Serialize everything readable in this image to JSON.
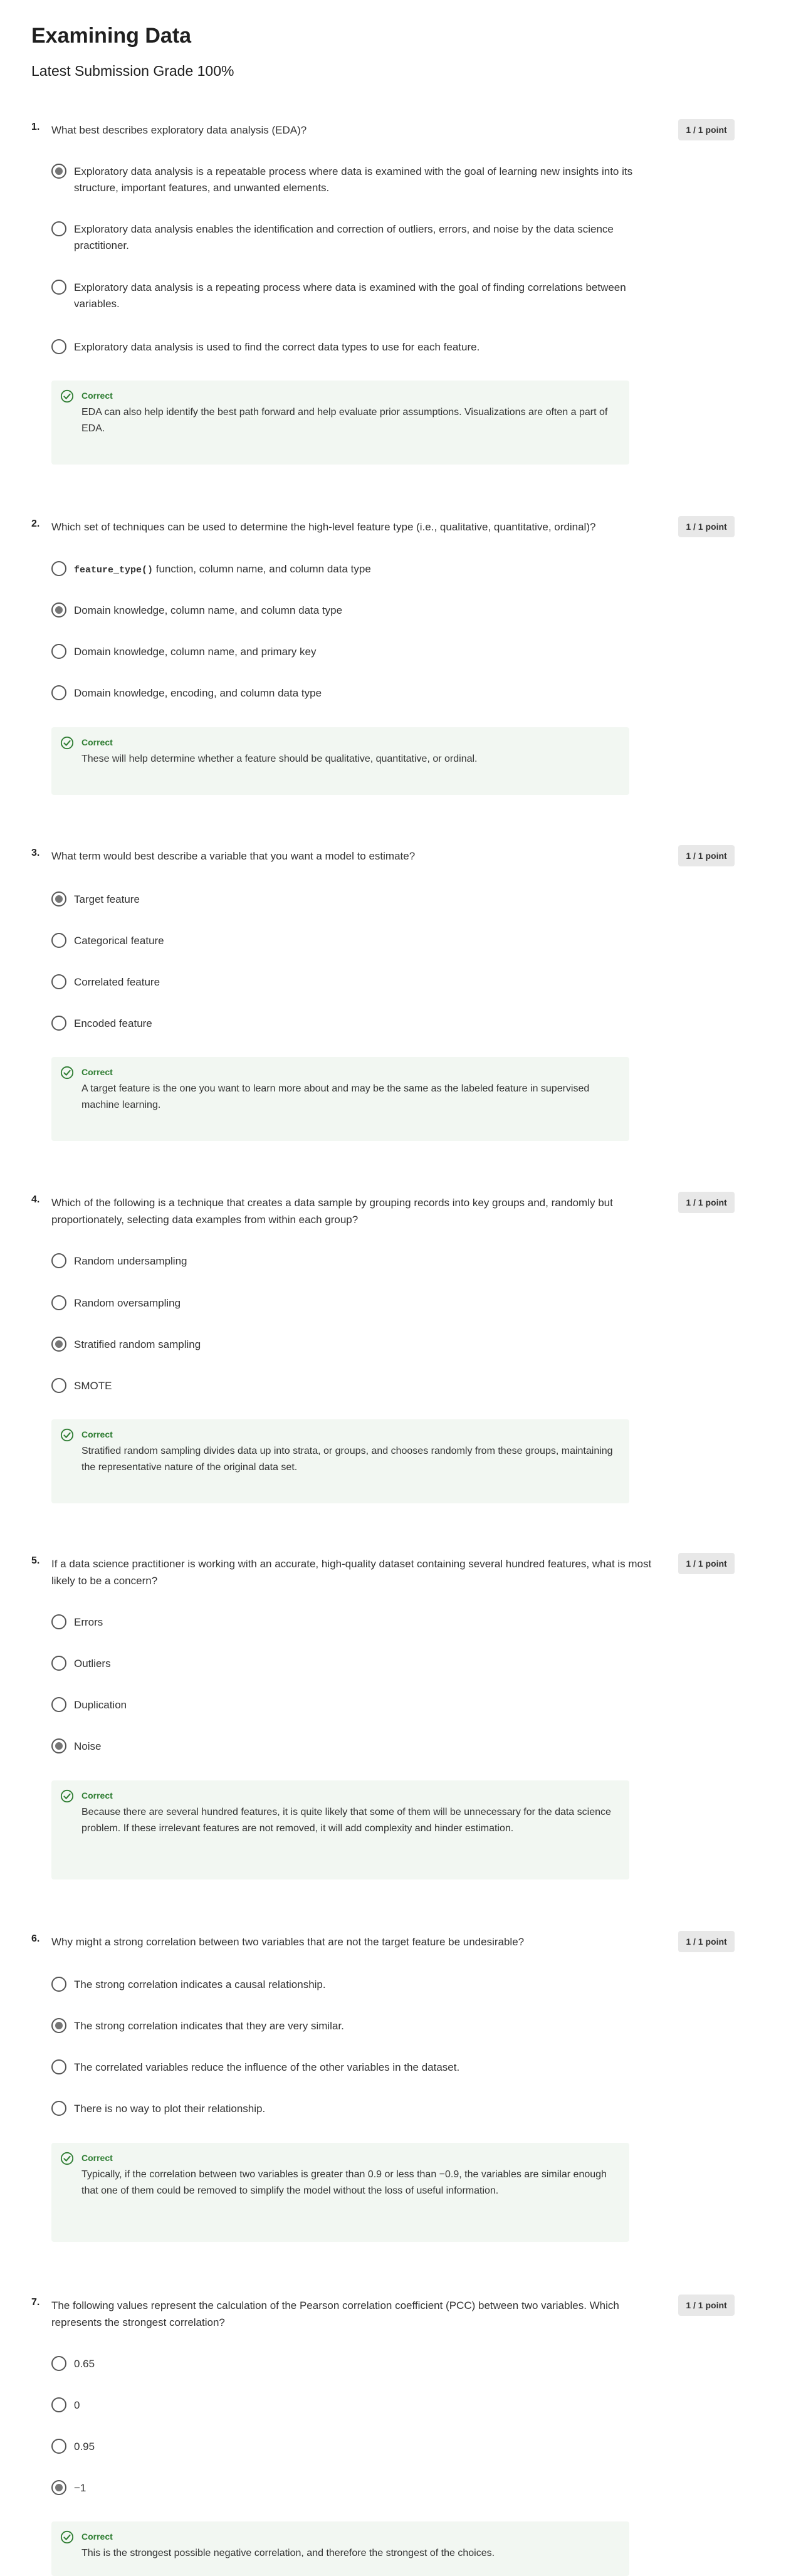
{
  "page": {
    "title": "Examining Data",
    "grade": "Latest Submission Grade 100%"
  },
  "icons": {
    "correct": "check-circle-icon",
    "radio": "radio-button-icon"
  },
  "colors": {
    "correct_green": "#2e7d32",
    "feedback_bg": "#f2f7f2",
    "points_bg": "#e8e8e8"
  },
  "questions": [
    {
      "number": "1.",
      "text": "What best describes exploratory data analysis (EDA)?",
      "points": "1 / 1 point",
      "options": [
        {
          "text": "Exploratory data analysis is a repeatable process where data is examined with the goal of learning new insights into its structure, important features, and unwanted elements.",
          "selected": true
        },
        {
          "text": "Exploratory data analysis enables the identification and correction of outliers, errors, and noise by the data science practitioner.",
          "selected": false
        },
        {
          "text": "Exploratory data analysis is a repeating process where data is examined with the goal of finding correlations between variables.",
          "selected": false
        },
        {
          "text": "Exploratory data analysis is used to find the correct data types to use for each feature.",
          "selected": false
        }
      ],
      "feedback": {
        "label": "Correct",
        "text": "EDA can also help identify the best path forward and help evaluate prior assumptions. Visualizations are often a part of EDA."
      }
    },
    {
      "number": "2.",
      "text": "Which set of techniques can be used to determine the high-level feature type (i.e., qualitative, quantitative, ordinal)?",
      "points": "1 / 1 point",
      "options": [
        {
          "code": "feature_type()",
          "text": " function, column name, and column data type",
          "selected": false
        },
        {
          "text": "Domain knowledge, column name, and column data type",
          "selected": true
        },
        {
          "text": "Domain knowledge, column name, and primary key",
          "selected": false
        },
        {
          "text": "Domain knowledge, encoding, and column data type",
          "selected": false
        }
      ],
      "feedback": {
        "label": "Correct",
        "text": "These will help determine whether a feature should be qualitative, quantitative, or ordinal."
      }
    },
    {
      "number": "3.",
      "text": "What term would best describe a variable that you want a model to estimate?",
      "points": "1 / 1 point",
      "options": [
        {
          "text": "Target feature",
          "selected": true
        },
        {
          "text": "Categorical feature",
          "selected": false
        },
        {
          "text": "Correlated feature",
          "selected": false
        },
        {
          "text": "Encoded feature",
          "selected": false
        }
      ],
      "feedback": {
        "label": "Correct",
        "text": "A target feature is the one you want to learn more about and may be the same as the labeled feature in supervised machine learning."
      }
    },
    {
      "number": "4.",
      "text": "Which of the following is a technique that creates a data sample by grouping records into key groups and, randomly but proportionately, selecting data examples from within each group?",
      "points": "1 / 1 point",
      "options": [
        {
          "text": "Random undersampling",
          "selected": false
        },
        {
          "text": "Random oversampling",
          "selected": false
        },
        {
          "text": "Stratified random sampling",
          "selected": true
        },
        {
          "text": "SMOTE",
          "selected": false
        }
      ],
      "feedback": {
        "label": "Correct",
        "text": "Stratified random sampling divides data up into strata, or groups, and chooses randomly from these groups, maintaining the representative nature of the original data set."
      }
    },
    {
      "number": "5.",
      "text": "If a data science practitioner is working with an accurate, high-quality dataset containing several hundred features, what is most likely to be a concern?",
      "points": "1 / 1 point",
      "options": [
        {
          "text": "Errors",
          "selected": false
        },
        {
          "text": "Outliers",
          "selected": false
        },
        {
          "text": "Duplication",
          "selected": false
        },
        {
          "text": "Noise",
          "selected": true
        }
      ],
      "feedback": {
        "label": "Correct",
        "text": "Because there are several hundred features, it is quite likely that some of them will be unnecessary for the data science problem. If these irrelevant features are not removed, it will add complexity and hinder estimation."
      }
    },
    {
      "number": "6.",
      "text": "Why might a strong correlation between two variables that are not the target feature be undesirable?",
      "points": "1 / 1 point",
      "options": [
        {
          "text": "The strong correlation indicates a causal relationship.",
          "selected": false
        },
        {
          "text": "The strong correlation indicates that they are very similar.",
          "selected": true
        },
        {
          "text": "The correlated variables reduce the influence of the other variables in the dataset.",
          "selected": false
        },
        {
          "text": "There is no way to plot their relationship.",
          "selected": false
        }
      ],
      "feedback": {
        "label": "Correct",
        "text": "Typically, if the correlation between two variables is greater than 0.9 or less than −0.9, the variables are similar enough that one of them could be removed to simplify the model without the loss of useful information."
      }
    },
    {
      "number": "7.",
      "text": "The following values represent the calculation of the Pearson correlation coefficient (PCC) between two variables. Which represents the strongest correlation?",
      "points": "1 / 1 point",
      "options": [
        {
          "text": "0.65",
          "selected": false
        },
        {
          "text": "0",
          "selected": false
        },
        {
          "text": "0.95",
          "selected": false
        },
        {
          "text": "−1",
          "selected": true
        }
      ],
      "feedback": {
        "label": "Correct",
        "text": "This is the strongest possible negative correlation, and therefore the strongest of the choices."
      }
    }
  ]
}
